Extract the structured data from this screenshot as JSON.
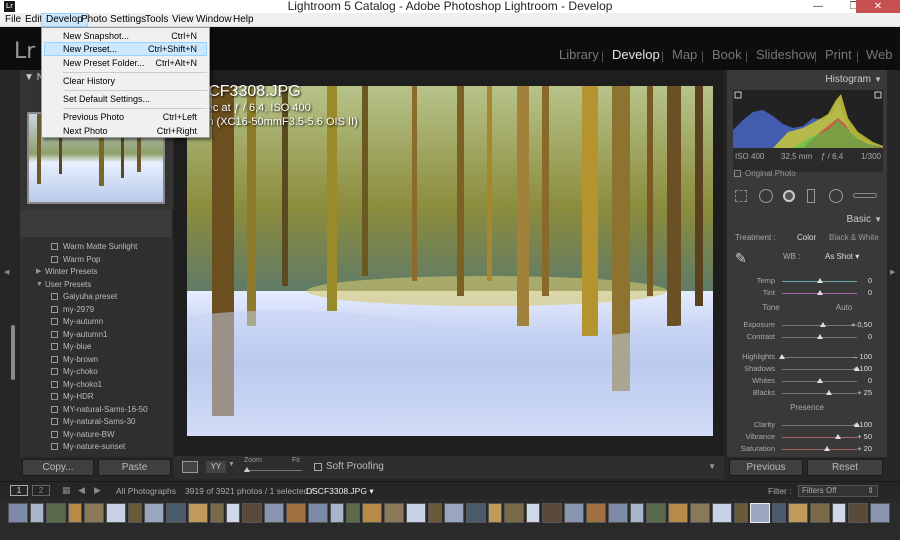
{
  "window": {
    "app_icon": "Lr",
    "title": "Lightroom 5 Catalog - Adobe Photoshop Lightroom - Develop",
    "minimize": "—",
    "maximize": "❐",
    "close": "✕"
  },
  "menubar": {
    "items": [
      "File",
      "Edit",
      "Develop",
      "Photo",
      "Settings",
      "Tools",
      "View",
      "Window",
      "Help"
    ],
    "active": "Develop"
  },
  "develop_menu": {
    "items": [
      {
        "label": "New Snapshot...",
        "shortcut": "Ctrl+N"
      },
      {
        "label": "New Preset...",
        "shortcut": "Ctrl+Shift+N"
      },
      {
        "label": "New Preset Folder...",
        "shortcut": "Ctrl+Alt+N"
      },
      {
        "label": "Clear History",
        "shortcut": ""
      },
      {
        "label": "Set Default Settings...",
        "shortcut": ""
      },
      {
        "label": "Previous Photo",
        "shortcut": "Ctrl+Left"
      },
      {
        "label": "Next Photo",
        "shortcut": "Ctrl+Right"
      }
    ],
    "highlighted": "New Preset..."
  },
  "identity": {
    "logo": "Lr",
    "modules": [
      "Library",
      "Develop",
      "Map",
      "Book",
      "Slideshow",
      "Print",
      "Web"
    ],
    "active_module": "Develop"
  },
  "left_panel": {
    "navigator_label": "N",
    "presets": [
      {
        "type": "preset",
        "label": "Warm Matte Sunlight"
      },
      {
        "type": "preset",
        "label": "Warm Pop"
      },
      {
        "type": "folder",
        "label": "Winter Presets"
      },
      {
        "type": "folder-open",
        "label": "User Presets"
      },
      {
        "type": "preset",
        "label": "Gaiyuha preset"
      },
      {
        "type": "preset",
        "label": "my-2979"
      },
      {
        "type": "preset",
        "label": "My-autumn"
      },
      {
        "type": "preset",
        "label": "My-autumn1"
      },
      {
        "type": "preset",
        "label": "My-blue"
      },
      {
        "type": "preset",
        "label": "My-brown"
      },
      {
        "type": "preset",
        "label": "My-choko"
      },
      {
        "type": "preset",
        "label": "My-choko1"
      },
      {
        "type": "preset",
        "label": "My-HDR"
      },
      {
        "type": "preset",
        "label": "MY-natural-Sams-16-50"
      },
      {
        "type": "preset",
        "label": "My-natural-Sams-30"
      },
      {
        "type": "preset",
        "label": "My-nature-BW"
      },
      {
        "type": "preset",
        "label": "My-nature-sunset"
      }
    ],
    "copy_button": "Copy...",
    "paste_button": "Paste"
  },
  "photo_info": {
    "filename": "DSCF3308.JPG",
    "exposure_line": "00 sec at ƒ / 6,4, ISO 400",
    "lens_line": "3 mm (XC16-50mmF3.5-5.6 OIS II)"
  },
  "toolbar": {
    "view_mode": "YY",
    "zoom_label": "Zoom",
    "fit_label": "Fit",
    "soft_proofing": "Soft Proofing"
  },
  "right_panel": {
    "histogram_title": "Histogram",
    "iso": "ISO 400",
    "focal": "32,5 mm",
    "aperture": "ƒ / 6,4",
    "shutter": "1/300",
    "original_photo": "Original Photo",
    "basic_title": "Basic",
    "treatment_label": "Treatment :",
    "treatment_color": "Color",
    "treatment_bw": "Black & White",
    "wb_label": "WB :",
    "wb_value": "As Shot",
    "tone_label": "Tone",
    "auto_label": "Auto",
    "presence_label": "Presence",
    "sliders": [
      {
        "name": "Temp",
        "value": "0",
        "pos": 0.5
      },
      {
        "name": "Tint",
        "value": "0",
        "pos": 0.5
      },
      {
        "name": "Exposure",
        "value": "+ 0,50",
        "pos": 0.55
      },
      {
        "name": "Contrast",
        "value": "0",
        "pos": 0.5
      },
      {
        "name": "Highlights",
        "value": "– 100",
        "pos": 0.0
      },
      {
        "name": "Shadows",
        "value": "+ 100",
        "pos": 1.0
      },
      {
        "name": "Whites",
        "value": "0",
        "pos": 0.5
      },
      {
        "name": "Blacks",
        "value": "+ 25",
        "pos": 0.62
      },
      {
        "name": "Clarity",
        "value": "+ 100",
        "pos": 1.0
      },
      {
        "name": "Vibrance",
        "value": "+ 50",
        "pos": 0.75
      },
      {
        "name": "Saturation",
        "value": "+ 20",
        "pos": 0.6
      }
    ],
    "previous_button": "Previous",
    "reset_button": "Reset"
  },
  "filmstrip": {
    "page1": "1",
    "page2": "2",
    "source": "All Photographs",
    "count": "3919 of 3921 photos / 1 selected /",
    "selected_file": "DSCF3308.JPG",
    "filter_label": "Filter :",
    "filter_value": "Filters Off"
  },
  "colors": {
    "accent_menu": "#cce8ff",
    "panel": "#393939",
    "background": "#262626"
  }
}
